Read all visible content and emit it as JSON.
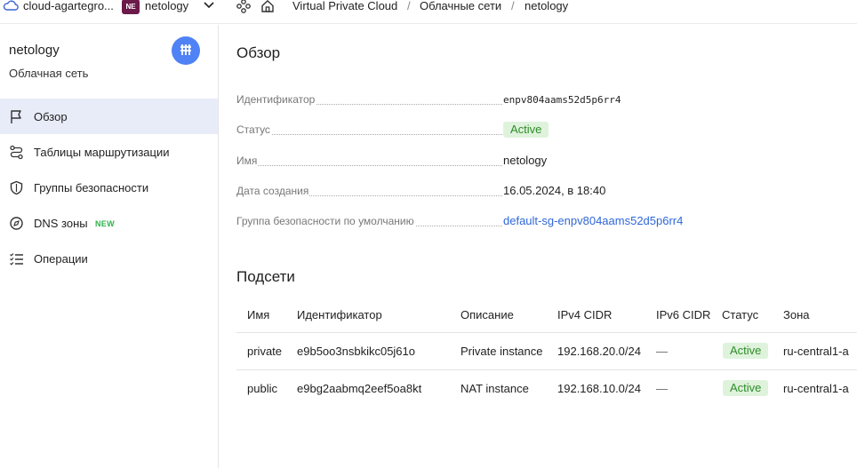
{
  "topbar": {
    "cloud_name": "cloud-agartegro...",
    "folder_badge": "NE",
    "folder_name": "netology",
    "breadcrumbs": [
      "Virtual Private Cloud",
      "Облачные сети",
      "netology"
    ],
    "separator": "/"
  },
  "sidebar": {
    "title": "netology",
    "subtitle": "Облачная сеть",
    "items": [
      {
        "label": "Обзор",
        "icon": "flag-icon",
        "active": true
      },
      {
        "label": "Таблицы маршрутизации",
        "icon": "route-icon"
      },
      {
        "label": "Группы безопасности",
        "icon": "shield-icon"
      },
      {
        "label": "DNS зоны",
        "icon": "dns-icon",
        "badge": "NEW"
      },
      {
        "label": "Операции",
        "icon": "list-icon"
      }
    ]
  },
  "overview": {
    "heading": "Обзор",
    "props": [
      {
        "label": "Идентификатор",
        "value": "enpv804aams52d5p6rr4"
      },
      {
        "label": "Статус",
        "value": "Active"
      },
      {
        "label": "Имя",
        "value": "netology"
      },
      {
        "label": "Дата создания",
        "value": "16.05.2024, в 18:40"
      },
      {
        "label": "Группа безопасности по умолчанию",
        "value": "default-sg-enpv804aams52d5p6rr4"
      }
    ]
  },
  "subnets": {
    "heading": "Подсети",
    "columns": [
      "Имя",
      "Идентификатор",
      "Описание",
      "IPv4 CIDR",
      "IPv6 CIDR",
      "Статус",
      "Зона"
    ],
    "rows": [
      {
        "name": "private",
        "id": "e9b5oo3nsbkikc05j61o",
        "description": "Private instance",
        "ipv4": "192.168.20.0/24",
        "ipv6": "—",
        "status": "Active",
        "zone": "ru-central1-a"
      },
      {
        "name": "public",
        "id": "e9bg2aabmq2eef5oa8kt",
        "description": "NAT instance",
        "ipv4": "192.168.10.0/24",
        "ipv6": "—",
        "status": "Active",
        "zone": "ru-central1-a"
      }
    ]
  },
  "colors": {
    "accent": "#4f82f5",
    "active_nav": "#e8ecf8",
    "status_bg": "#dff3dc",
    "status_fg": "#2e8c2a",
    "link": "#2f67d8",
    "badge_new": "#2fb34d"
  }
}
